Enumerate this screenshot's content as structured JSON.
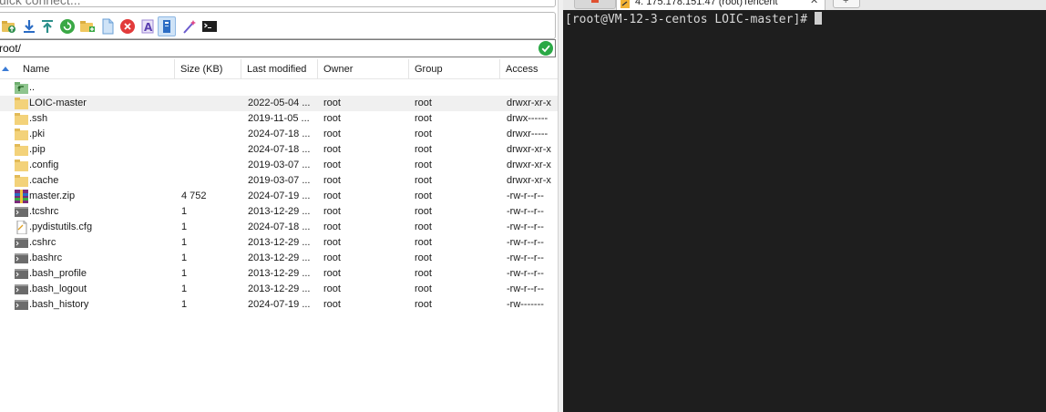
{
  "sftp": {
    "quick_connect_placeholder": "uick connect...",
    "toolbar": [
      {
        "name": "upload-folder-icon"
      },
      {
        "name": "download-icon"
      },
      {
        "name": "upload-icon"
      },
      {
        "name": "refresh-icon"
      },
      {
        "name": "new-folder-icon"
      },
      {
        "name": "new-file-icon"
      },
      {
        "name": "delete-icon"
      },
      {
        "name": "rename-icon"
      },
      {
        "name": "properties-icon"
      },
      {
        "name": "settings-wand-icon"
      },
      {
        "name": "terminal-icon"
      }
    ],
    "path": "root/",
    "columns": {
      "name": "Name",
      "size": "Size (KB)",
      "modified": "Last modified",
      "owner": "Owner",
      "group": "Group",
      "access": "Access"
    },
    "files": [
      {
        "icon": "parent-dir-icon",
        "name": "..",
        "size": "",
        "modified": "",
        "owner": "",
        "group": "",
        "access": ""
      },
      {
        "icon": "folder-icon",
        "name": "LOIC-master",
        "size": "",
        "modified": "2022-05-04 ...",
        "owner": "root",
        "group": "root",
        "access": "drwxr-xr-x"
      },
      {
        "icon": "folder-icon",
        "name": ".ssh",
        "size": "",
        "modified": "2019-11-05 ...",
        "owner": "root",
        "group": "root",
        "access": "drwx------"
      },
      {
        "icon": "folder-icon",
        "name": ".pki",
        "size": "",
        "modified": "2024-07-18 ...",
        "owner": "root",
        "group": "root",
        "access": "drwxr-----"
      },
      {
        "icon": "folder-icon",
        "name": ".pip",
        "size": "",
        "modified": "2024-07-18 ...",
        "owner": "root",
        "group": "root",
        "access": "drwxr-xr-x"
      },
      {
        "icon": "folder-icon",
        "name": ".config",
        "size": "",
        "modified": "2019-03-07 ...",
        "owner": "root",
        "group": "root",
        "access": "drwxr-xr-x"
      },
      {
        "icon": "folder-icon",
        "name": ".cache",
        "size": "",
        "modified": "2019-03-07 ...",
        "owner": "root",
        "group": "root",
        "access": "drwxr-xr-x"
      },
      {
        "icon": "zip-archive-icon",
        "name": "master.zip",
        "size": "4 752",
        "modified": "2024-07-19 ...",
        "owner": "root",
        "group": "root",
        "access": "-rw-r--r--"
      },
      {
        "icon": "shell-file-icon",
        "name": ".tcshrc",
        "size": "1",
        "modified": "2013-12-29 ...",
        "owner": "root",
        "group": "root",
        "access": "-rw-r--r--"
      },
      {
        "icon": "text-file-icon",
        "name": ".pydistutils.cfg",
        "size": "1",
        "modified": "2024-07-18 ...",
        "owner": "root",
        "group": "root",
        "access": "-rw-r--r--"
      },
      {
        "icon": "shell-file-icon",
        "name": ".cshrc",
        "size": "1",
        "modified": "2013-12-29 ...",
        "owner": "root",
        "group": "root",
        "access": "-rw-r--r--"
      },
      {
        "icon": "shell-file-icon",
        "name": ".bashrc",
        "size": "1",
        "modified": "2013-12-29 ...",
        "owner": "root",
        "group": "root",
        "access": "-rw-r--r--"
      },
      {
        "icon": "shell-file-icon",
        "name": ".bash_profile",
        "size": "1",
        "modified": "2013-12-29 ...",
        "owner": "root",
        "group": "root",
        "access": "-rw-r--r--"
      },
      {
        "icon": "shell-file-icon",
        "name": ".bash_logout",
        "size": "1",
        "modified": "2013-12-29 ...",
        "owner": "root",
        "group": "root",
        "access": "-rw-r--r--"
      },
      {
        "icon": "shell-file-icon",
        "name": ".bash_history",
        "size": "1",
        "modified": "2024-07-19 ...",
        "owner": "root",
        "group": "root",
        "access": "-rw-------"
      }
    ]
  },
  "terminal": {
    "tab_title": "4. 175.178.151.47 (root)Tencent",
    "tab_close": "✕",
    "tab_add": "+",
    "prompt": "[root@VM-12-3-centos LOIC-master]# "
  },
  "colors": {
    "terminal_bg": "#1e1e1e",
    "terminal_fg": "#d8d8d8",
    "selected_row": "#f0f0f0",
    "accent_blue": "#3a7bd5",
    "ok_green": "#2aa845"
  }
}
